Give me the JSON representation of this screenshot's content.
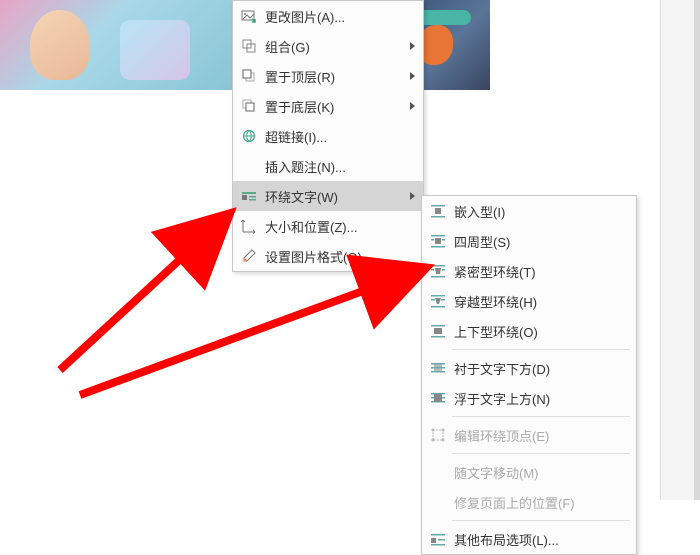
{
  "menu1": {
    "items": [
      {
        "label": "更改图片(A)..."
      },
      {
        "label": "组合(G)"
      },
      {
        "label": "置于顶层(R)"
      },
      {
        "label": "置于底层(K)"
      },
      {
        "label": "超链接(I)..."
      },
      {
        "label": "插入题注(N)..."
      },
      {
        "label": "环绕文字(W)"
      },
      {
        "label": "大小和位置(Z)..."
      },
      {
        "label": "设置图片格式(O)..."
      }
    ]
  },
  "menu2": {
    "items": [
      {
        "label": "嵌入型(I)"
      },
      {
        "label": "四周型(S)"
      },
      {
        "label": "紧密型环绕(T)"
      },
      {
        "label": "穿越型环绕(H)"
      },
      {
        "label": "上下型环绕(O)"
      },
      {
        "label": "衬于文字下方(D)"
      },
      {
        "label": "浮于文字上方(N)"
      },
      {
        "label": "编辑环绕顶点(E)"
      },
      {
        "label": "随文字移动(M)"
      },
      {
        "label": "修复页面上的位置(F)"
      },
      {
        "label": "其他布局选项(L)..."
      }
    ]
  },
  "colors": {
    "arrow": "#ff0000"
  }
}
